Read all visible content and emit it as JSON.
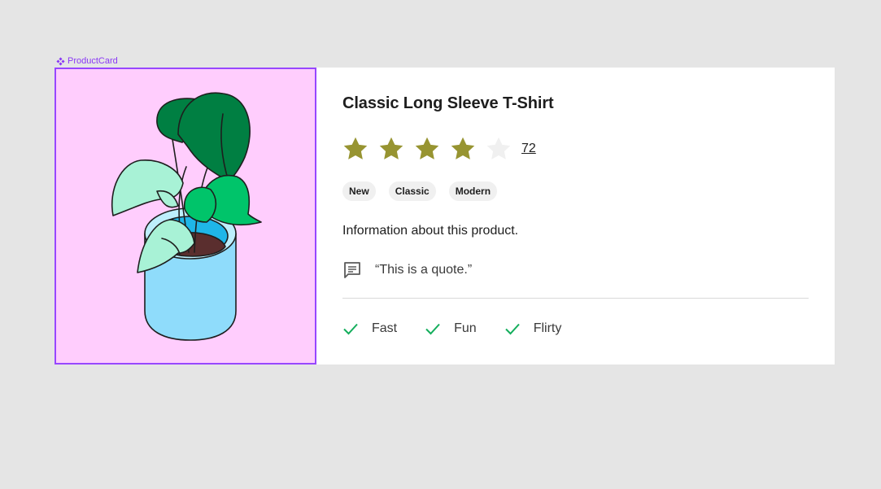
{
  "component": {
    "label": "ProductCard",
    "icon": "component-icon",
    "accent": "#8a38f5"
  },
  "product": {
    "image": {
      "icon": "plant-illustration",
      "background": "#ffcdfd"
    },
    "title": "Classic Long Sleeve T-Shirt",
    "rating": {
      "value": 4,
      "max": 5,
      "count": "72",
      "filled_color": "#979431",
      "empty_color": "#f0f0f0"
    },
    "tags": [
      "New",
      "Classic",
      "Modern"
    ],
    "description": "Information about this product.",
    "quote": {
      "icon": "message-square-icon",
      "text": "“This is a quote.”"
    },
    "features": [
      {
        "icon": "check-icon",
        "label": "Fast"
      },
      {
        "icon": "check-icon",
        "label": "Fun"
      },
      {
        "icon": "check-icon",
        "label": "Flirty"
      }
    ],
    "check_color": "#14ae5c"
  }
}
